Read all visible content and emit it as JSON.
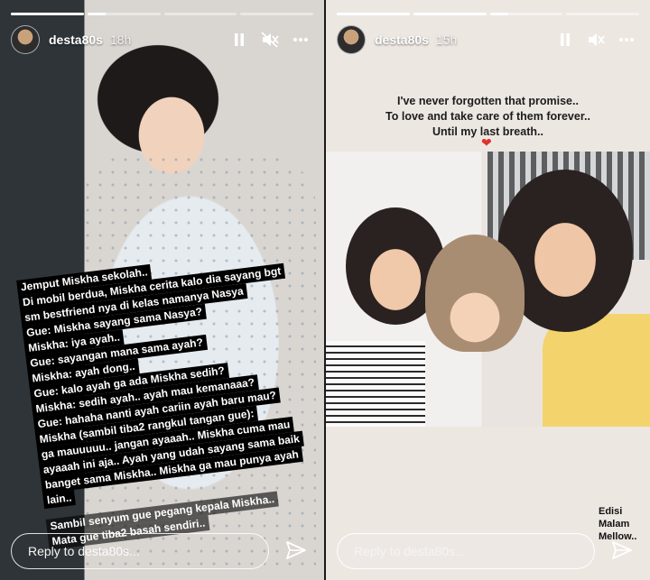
{
  "stories": [
    {
      "username": "desta80s",
      "time": "18h",
      "progress": [
        1.0,
        0.25,
        0.0,
        0.0
      ],
      "text_lines": [
        "Jemput Miskha sekolah..",
        "Di mobil berdua, Miskha cerita kalo dia sayang bgt",
        "sm bestfriend nya di kelas namanya Nasya",
        "Gue: Miskha sayang sama Nasya?",
        "Miskha: iya ayah..",
        "Gue: sayangan mana sama ayah?",
        "Miskha: ayah dong..",
        "Gue: kalo ayah ga ada Miskha sedih?",
        "Miskha: sedih ayah.. ayah mau kemanaaa?",
        "Gue: hahaha nanti ayah cariin ayah baru mau?",
        "Miskha (sambil tiba2 rangkul tangan gue):",
        "ga mauuuuu.. jangan ayaaah.. Miskha cuma mau",
        "ayaaah ini aja.. Ayah yang udah sayang sama baik",
        "banget sama Miskha.. Miskha ga mau punya ayah",
        "lain.."
      ],
      "text_lines_2": [
        "Sambil senyum gue pegang kepala Miskha..",
        "Mata gue tiba2 basah sendiri.."
      ],
      "reply_placeholder": "Reply to desta80s..."
    },
    {
      "username": "desta80s",
      "time": "15h",
      "progress": [
        1.0,
        1.0,
        0.25,
        0.0
      ],
      "caption_lines": [
        "I've never forgotten that promise..",
        "To love and take care of them forever..",
        "Until my last breath.."
      ],
      "heart": "❤",
      "edisi_lines": [
        "Edisi",
        "Malam",
        "Mellow.."
      ],
      "reply_placeholder": "Reply to desta80s..."
    }
  ]
}
